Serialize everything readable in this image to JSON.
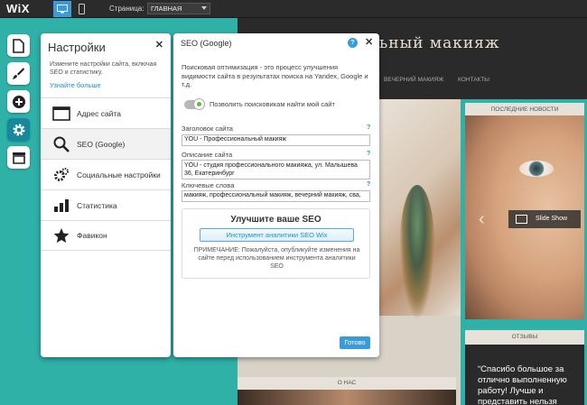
{
  "topbar": {
    "logo": "WiX",
    "page_label": "Страница:",
    "page_select": "ГЛАВНАЯ"
  },
  "site": {
    "title": "ьный макияж",
    "nav": [
      "ВЕЧЕРНИЙ МАКИЯЖ",
      "КОНТАКТЫ"
    ],
    "latest_news": "ПОСЛЕДНИЕ НОВОСТИ",
    "slideshow": "Slide Show",
    "reviews": "ОТЗЫВЫ",
    "testimonial": "“Спасибо большое за отлично выполненную работу! Лучше и представить нельзя",
    "about": "О НАС"
  },
  "settings": {
    "title": "Настройки",
    "description": "Измените настройки сайта, включая SEO и статистику.",
    "learn_more": "Узнайте больше",
    "items": [
      {
        "label": "Адрес сайта",
        "icon": "browser-window-icon"
      },
      {
        "label": "SEO (Google)",
        "icon": "magnifier-icon"
      },
      {
        "label": "Социальные настройки",
        "icon": "social-gears-icon"
      },
      {
        "label": "Статистика",
        "icon": "bar-chart-icon"
      },
      {
        "label": "Фавикон",
        "icon": "star-icon"
      }
    ]
  },
  "seo": {
    "title": "SEO (Google)",
    "help": "?",
    "intro": "Поисковая оптимизация - это процесс улучшения видимости сайта в результатах поиска на Yandex, Google и т.д.",
    "toggle_label": "Позволить поисковикам найти мой сайт",
    "toggle_on": true,
    "title_label": "Заголовок сайта",
    "title_value": "YOU - Профессиональный макияж",
    "desc_label": "Описание сайта",
    "desc_value": "YOU - студия профессионального макияжа, ул. Малышева 36, Екатеринбург",
    "keywords_label": "Ключевые слова",
    "keywords_value": "макияж, профессиональный макияж, вечерний макияж, сва,",
    "improve_title": "Улучшите ваше SEO",
    "improve_button": "Инструмент аналитики SEO Wix",
    "improve_note": "ПРИМЕЧАНИЕ: Пожалуйста, опубликуйте изменения на сайте перед использованием инструмента аналитики SEO",
    "done": "Готово"
  },
  "colors": {
    "accent": "#3a9bdc",
    "teal": "#2fb1a8",
    "rail_active": "#15899b"
  }
}
